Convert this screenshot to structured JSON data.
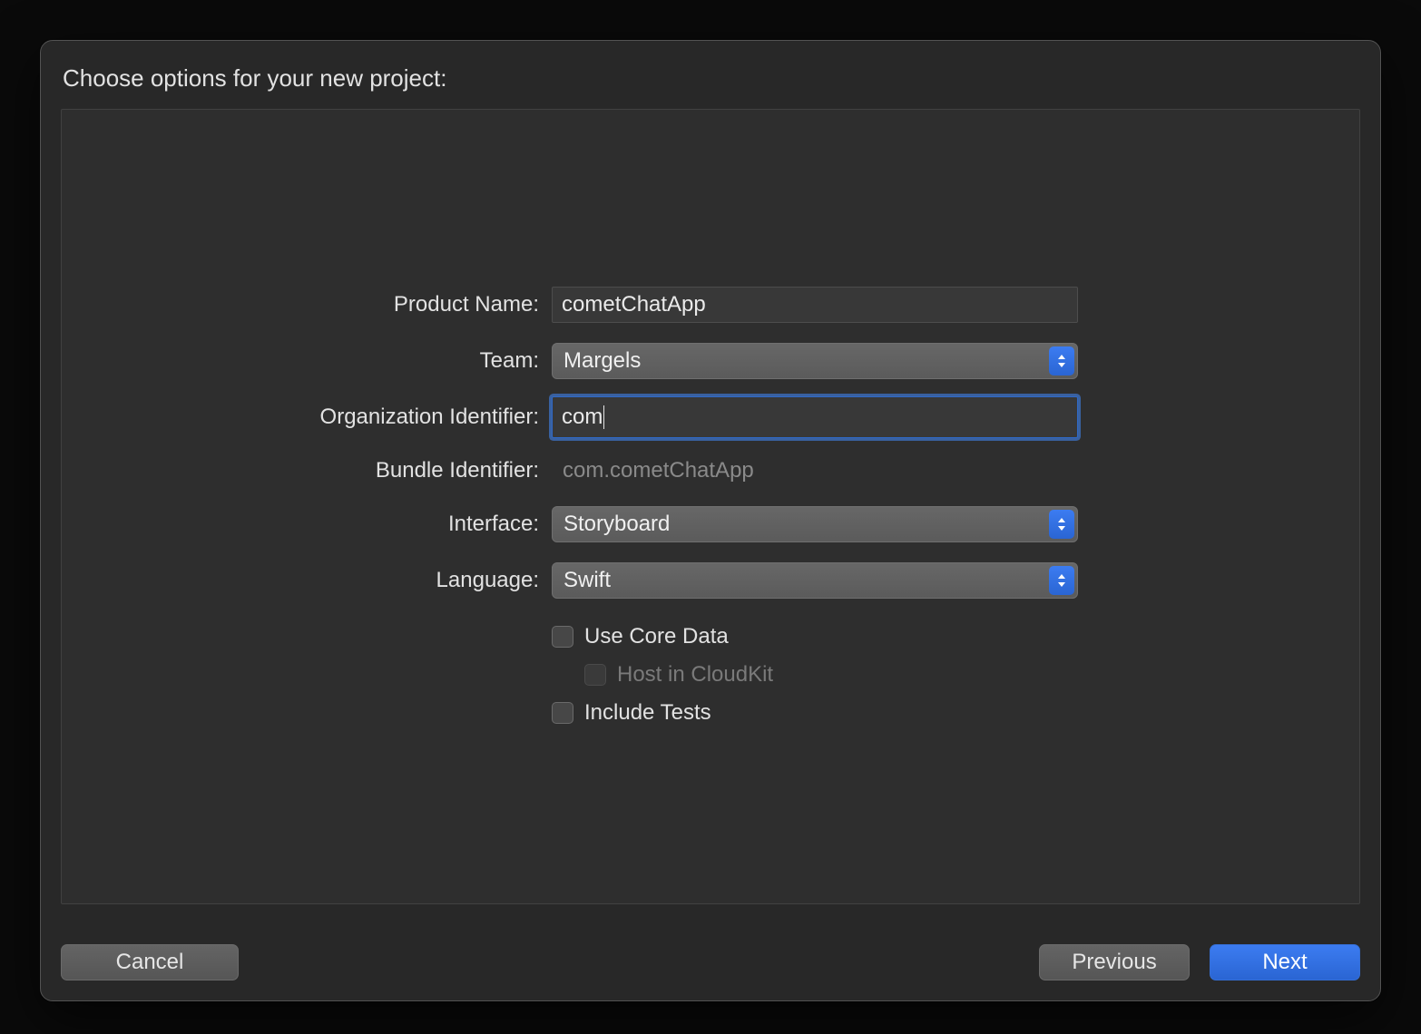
{
  "title": "Choose options for your new project:",
  "form": {
    "productName": {
      "label": "Product Name:",
      "value": "cometChatApp"
    },
    "team": {
      "label": "Team:",
      "value": "Margels"
    },
    "orgId": {
      "label": "Organization Identifier:",
      "value": "com"
    },
    "bundleId": {
      "label": "Bundle Identifier:",
      "value": "com.cometChatApp"
    },
    "interface": {
      "label": "Interface:",
      "value": "Storyboard"
    },
    "language": {
      "label": "Language:",
      "value": "Swift"
    },
    "useCoreData": {
      "label": "Use Core Data"
    },
    "hostCloudKit": {
      "label": "Host in CloudKit"
    },
    "includeTests": {
      "label": "Include Tests"
    }
  },
  "buttons": {
    "cancel": "Cancel",
    "previous": "Previous",
    "next": "Next"
  }
}
